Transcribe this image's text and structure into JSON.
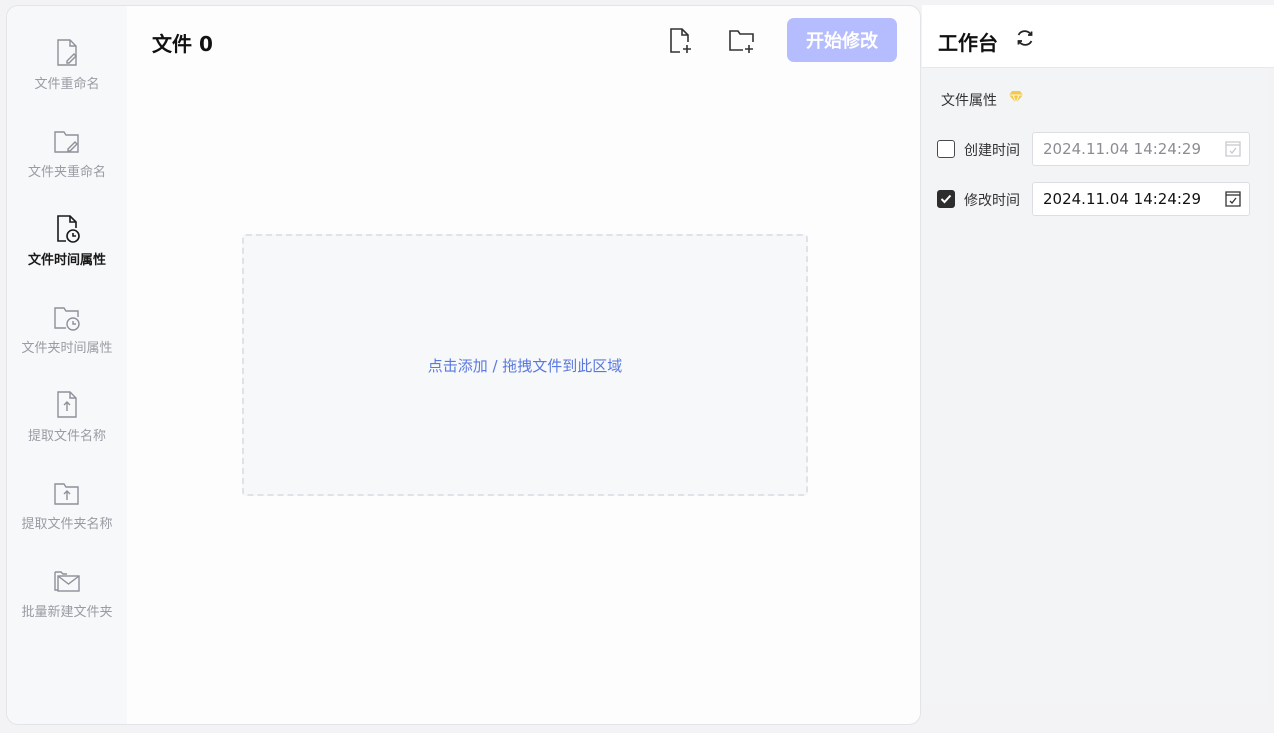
{
  "sidebar": {
    "items": [
      {
        "label": "文件重命名",
        "icon": "file-rename-icon",
        "active": false
      },
      {
        "label": "文件夹重命名",
        "icon": "folder-rename-icon",
        "active": false
      },
      {
        "label": "文件时间属性",
        "icon": "file-time-icon",
        "active": true
      },
      {
        "label": "文件夹时间属性",
        "icon": "folder-time-icon",
        "active": false
      },
      {
        "label": "提取文件名称",
        "icon": "file-extract-icon",
        "active": false
      },
      {
        "label": "提取文件夹名称",
        "icon": "folder-extract-icon",
        "active": false
      },
      {
        "label": "批量新建文件夹",
        "icon": "batch-folder-icon",
        "active": false
      }
    ]
  },
  "main": {
    "title": "文件 0",
    "start_button": "开始修改",
    "dropzone_text": "点击添加 / 拖拽文件到此区域"
  },
  "workbench": {
    "title": "工作台",
    "section_title": "文件属性",
    "create_time": {
      "label": "创建时间",
      "value": "2024.11.04 14:24:29",
      "checked": false
    },
    "modify_time": {
      "label": "修改时间",
      "value": "2024.11.04 14:24:29",
      "checked": true
    }
  },
  "colors": {
    "accent_button": "#b6bdff",
    "link_blue": "#5a79e0",
    "premium_gold": "#f2c94c"
  }
}
